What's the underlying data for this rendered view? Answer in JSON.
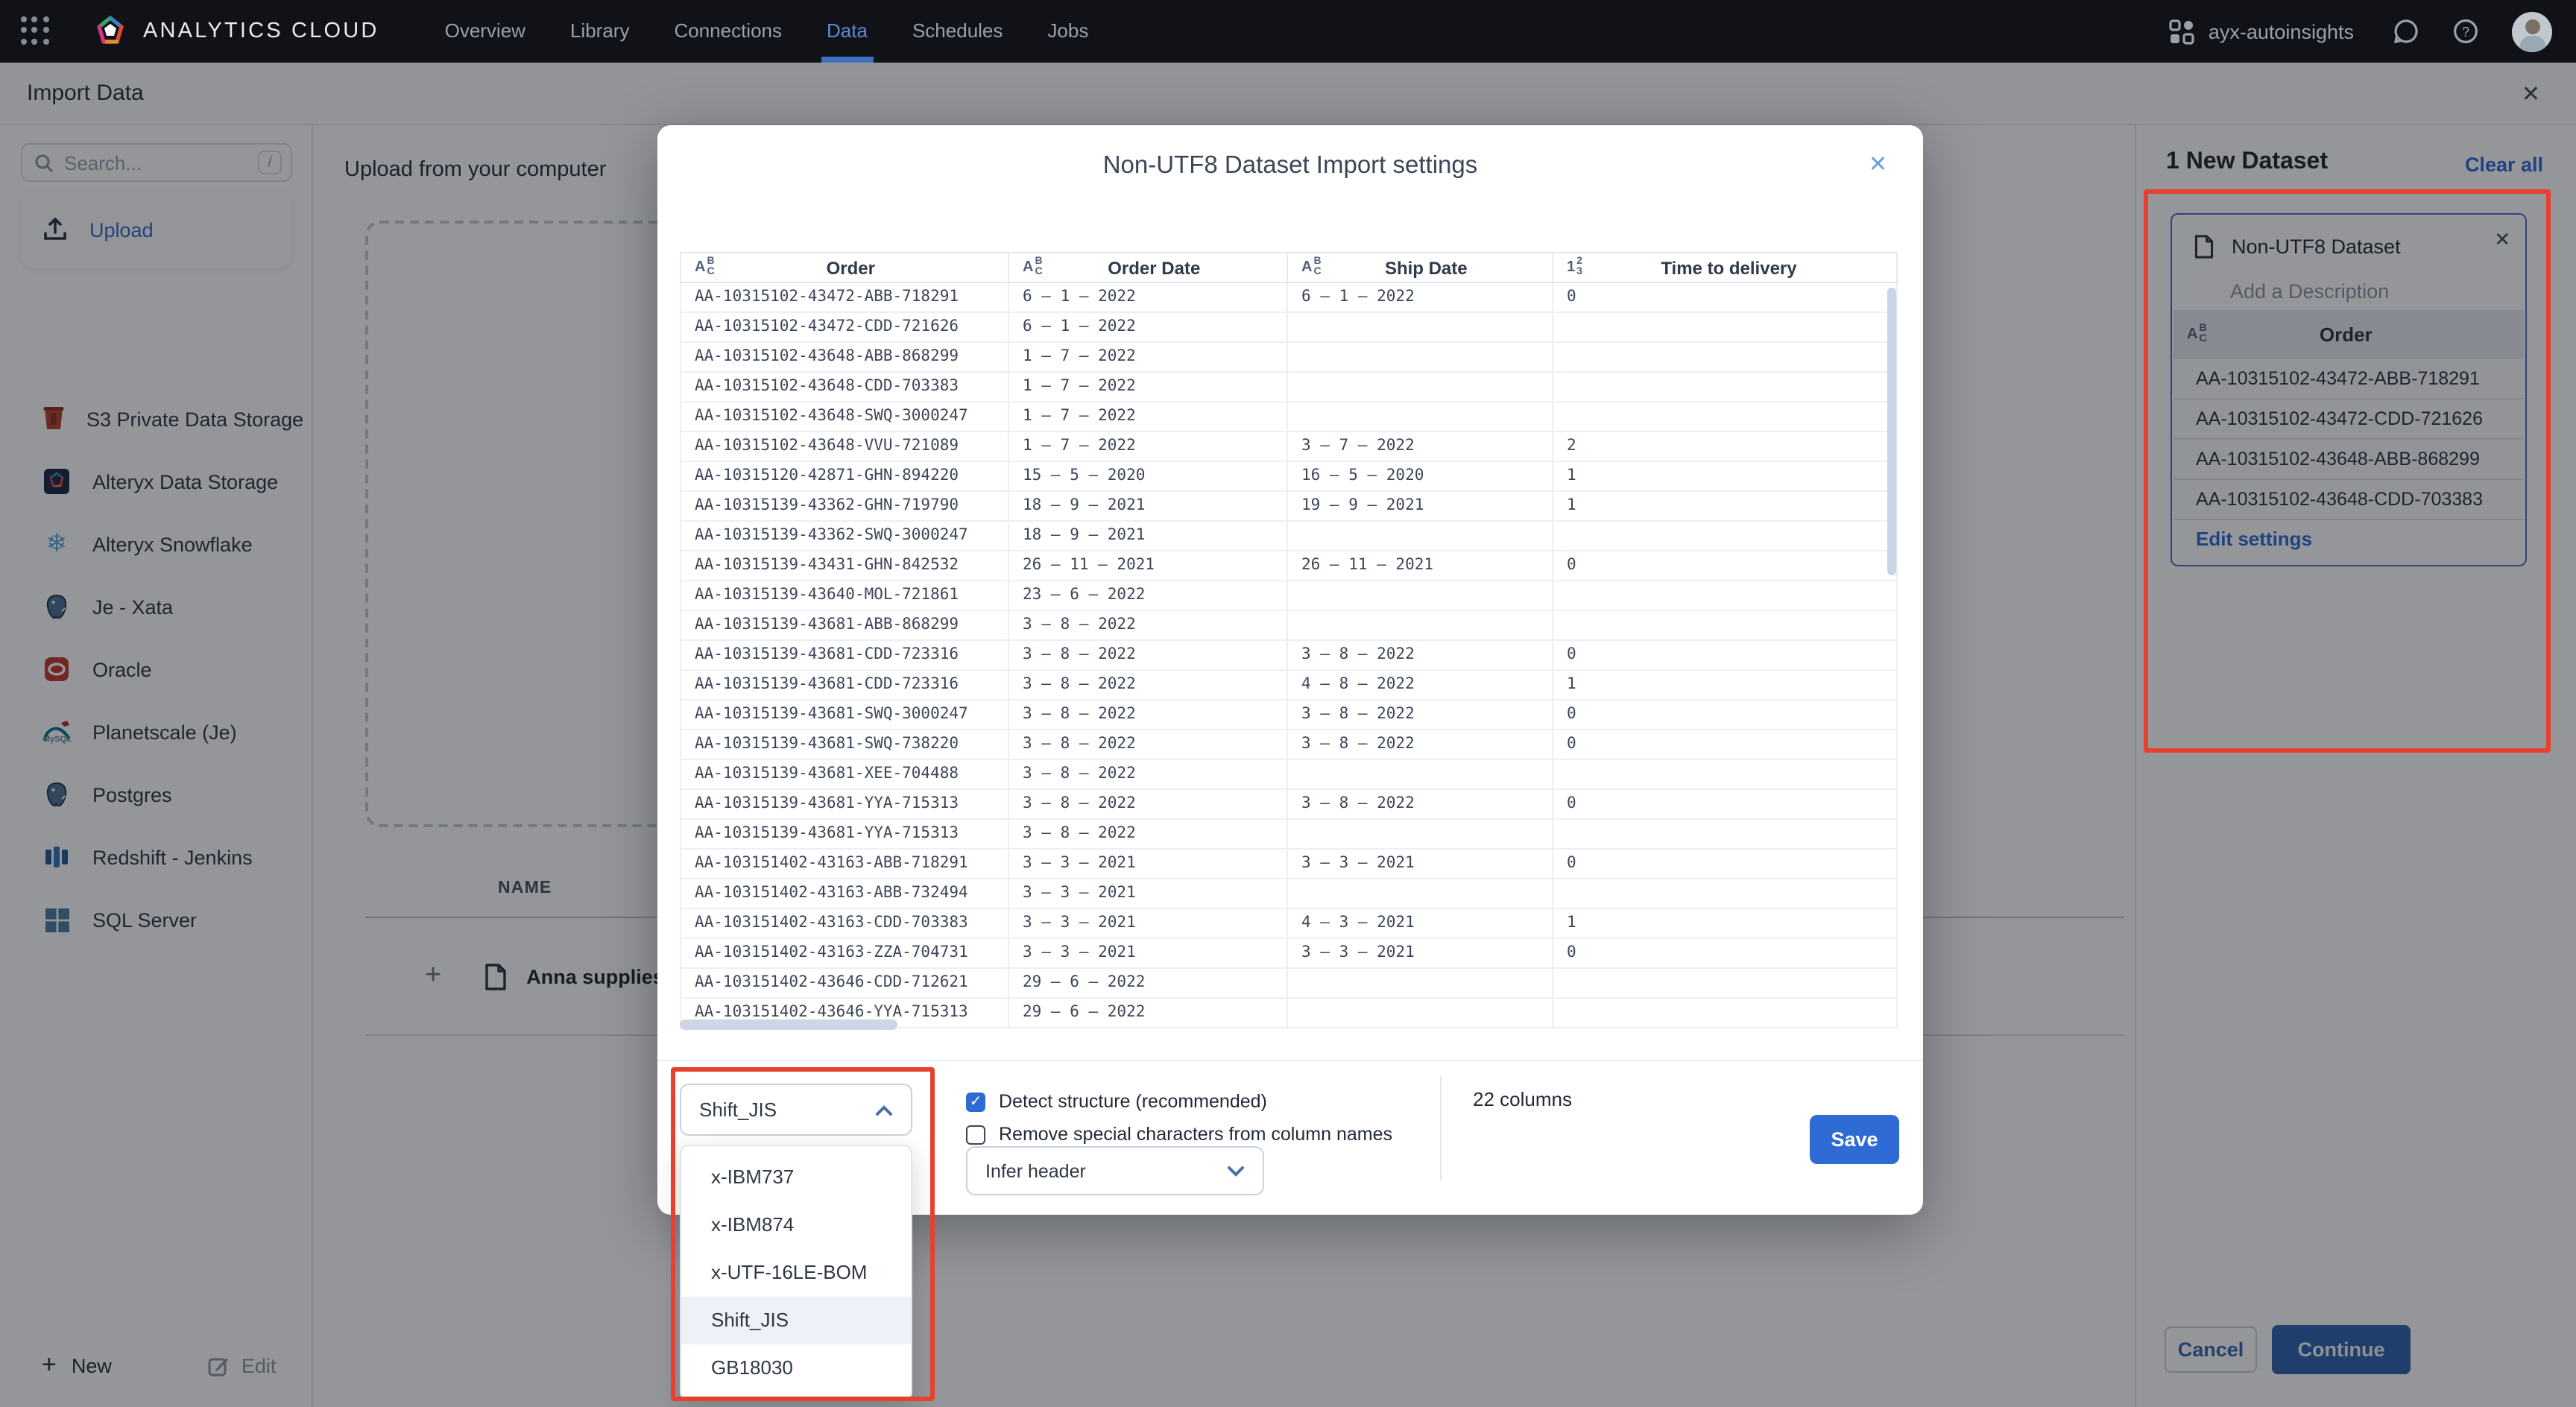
{
  "topnav": {
    "brand": "ANALYTICS CLOUD",
    "links": [
      {
        "label": "Overview",
        "active": false
      },
      {
        "label": "Library",
        "active": false
      },
      {
        "label": "Connections",
        "active": false
      },
      {
        "label": "Data",
        "active": true
      },
      {
        "label": "Schedules",
        "active": false
      },
      {
        "label": "Jobs",
        "active": false
      }
    ],
    "workspace": "ayx-autoinsights"
  },
  "page": {
    "title": "Import Data"
  },
  "sidebar": {
    "search_placeholder": "Search...",
    "search_shortcut": "/",
    "upload_label": "Upload",
    "sources": [
      {
        "label": "S3 Private Data Storage",
        "icon": "s3-icon"
      },
      {
        "label": "Alteryx Data Storage",
        "icon": "alteryx-storage-icon"
      },
      {
        "label": "Alteryx Snowflake",
        "icon": "snowflake-icon"
      },
      {
        "label": "Je - Xata",
        "icon": "postgres-icon"
      },
      {
        "label": "Oracle",
        "icon": "oracle-icon"
      },
      {
        "label": "Planetscale (Je)",
        "icon": "mysql-icon"
      },
      {
        "label": "Postgres",
        "icon": "postgres-icon"
      },
      {
        "label": "Redshift - Jenkins",
        "icon": "redshift-icon"
      },
      {
        "label": "SQL Server",
        "icon": "sqlserver-icon"
      }
    ],
    "new_label": "New",
    "edit_label": "Edit"
  },
  "content": {
    "heading": "Upload from your computer",
    "table_header": "NAME",
    "file_name": "Anna supplies"
  },
  "modal": {
    "title": "Non-UTF8 Dataset Import settings",
    "columns": [
      {
        "name": "Order",
        "type": "text"
      },
      {
        "name": "Order Date",
        "type": "text"
      },
      {
        "name": "Ship Date",
        "type": "text"
      },
      {
        "name": "Time to delivery",
        "type": "number"
      }
    ],
    "rows": [
      [
        "AA-10315102-43472-ABB-718291",
        "6 – 1 – 2022",
        "6 – 1 – 2022",
        "0"
      ],
      [
        "AA-10315102-43472-CDD-721626",
        "6 – 1 – 2022",
        "",
        ""
      ],
      [
        "AA-10315102-43648-ABB-868299",
        "1 – 7 – 2022",
        "",
        ""
      ],
      [
        "AA-10315102-43648-CDD-703383",
        "1 – 7 – 2022",
        "",
        ""
      ],
      [
        "AA-10315102-43648-SWQ-3000247",
        "1 – 7 – 2022",
        "",
        ""
      ],
      [
        "AA-10315102-43648-VVU-721089",
        "1 – 7 – 2022",
        "3 – 7 – 2022",
        "2"
      ],
      [
        "AA-10315120-42871-GHN-894220",
        "15 – 5 – 2020",
        "16 – 5 – 2020",
        "1"
      ],
      [
        "AA-10315139-43362-GHN-719790",
        "18 – 9 – 2021",
        "19 – 9 – 2021",
        "1"
      ],
      [
        "AA-10315139-43362-SWQ-3000247",
        "18 – 9 – 2021",
        "",
        ""
      ],
      [
        "AA-10315139-43431-GHN-842532",
        "26 – 11 – 2021",
        "26 – 11 – 2021",
        "0"
      ],
      [
        "AA-10315139-43640-MOL-721861",
        "23 – 6 – 2022",
        "",
        ""
      ],
      [
        "AA-10315139-43681-ABB-868299",
        "3 – 8 – 2022",
        "",
        ""
      ],
      [
        "AA-10315139-43681-CDD-723316",
        "3 – 8 – 2022",
        "3 – 8 – 2022",
        "0"
      ],
      [
        "AA-10315139-43681-CDD-723316",
        "3 – 8 – 2022",
        "4 – 8 – 2022",
        "1"
      ],
      [
        "AA-10315139-43681-SWQ-3000247",
        "3 – 8 – 2022",
        "3 – 8 – 2022",
        "0"
      ],
      [
        "AA-10315139-43681-SWQ-738220",
        "3 – 8 – 2022",
        "3 – 8 – 2022",
        "0"
      ],
      [
        "AA-10315139-43681-XEE-704488",
        "3 – 8 – 2022",
        "",
        ""
      ],
      [
        "AA-10315139-43681-YYA-715313",
        "3 – 8 – 2022",
        "3 – 8 – 2022",
        "0"
      ],
      [
        "AA-10315139-43681-YYA-715313",
        "3 – 8 – 2022",
        "",
        ""
      ],
      [
        "AA-103151402-43163-ABB-718291",
        "3 – 3 – 2021",
        "3 – 3 – 2021",
        "0"
      ],
      [
        "AA-103151402-43163-ABB-732494",
        "3 – 3 – 2021",
        "",
        ""
      ],
      [
        "AA-103151402-43163-CDD-703383",
        "3 – 3 – 2021",
        "4 – 3 – 2021",
        "1"
      ],
      [
        "AA-103151402-43163-ZZA-704731",
        "3 – 3 – 2021",
        "3 – 3 – 2021",
        "0"
      ],
      [
        "AA-103151402-43646-CDD-712621",
        "29 – 6 – 2022",
        "",
        ""
      ],
      [
        "AA-103151402-43646-YYA-715313",
        "29 – 6 – 2022",
        "",
        ""
      ]
    ],
    "encoding": {
      "value": "Shift_JIS",
      "options": [
        "x-IBM737",
        "x-IBM874",
        "x-UTF-16LE-BOM",
        "Shift_JIS",
        "GB18030"
      ]
    },
    "detect_structure": {
      "label": "Detect structure (recommended)",
      "checked": true
    },
    "remove_special": {
      "label": "Remove special characters from column names",
      "checked": false
    },
    "header_mode": "Infer header",
    "columns_count": "22 columns",
    "save_label": "Save"
  },
  "right_panel": {
    "header": "1 New Dataset",
    "clear_all": "Clear all",
    "dataset": {
      "name": "Non-UTF8 Dataset",
      "description_placeholder": "Add a Description",
      "column": "Order",
      "values": [
        "AA-10315102-43472-ABB-718291",
        "AA-10315102-43472-CDD-721626",
        "AA-10315102-43648-ABB-868299",
        "AA-10315102-43648-CDD-703383"
      ],
      "edit_settings": "Edit settings"
    },
    "cancel_label": "Cancel",
    "continue_label": "Continue"
  },
  "colors": {
    "nav_bg": "#101218",
    "accent_blue": "#2e6bd4",
    "active_tab_blue": "#3f6fc0",
    "annotation_red": "#e8402f",
    "card_border_blue": "#4c6fc0",
    "save_button": "#2e6bd4",
    "continue_button": "#2e62ad"
  }
}
